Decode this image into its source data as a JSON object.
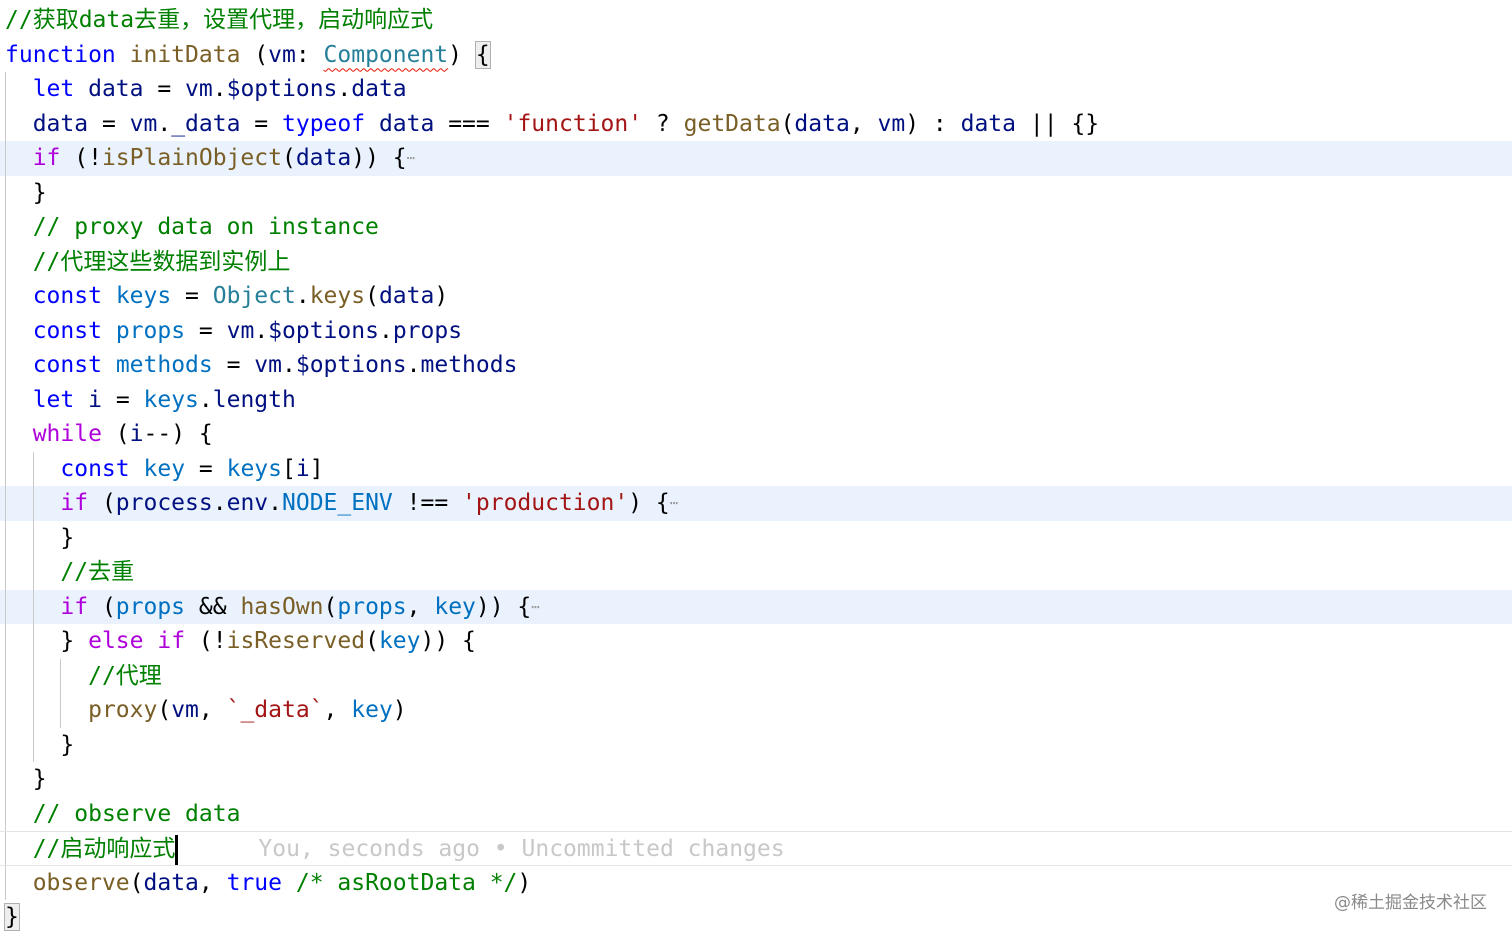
{
  "lines": [
    {
      "indent": 0,
      "tokens": [
        [
          "//获取data去重，设置代理，启动响应式",
          "cm"
        ]
      ]
    },
    {
      "indent": 0,
      "tokens": [
        [
          "function",
          "kw"
        ],
        [
          " ",
          "pl"
        ],
        [
          "initData",
          "fn"
        ],
        [
          " (",
          "pl"
        ],
        [
          "vm",
          "var"
        ],
        [
          ": ",
          "pl"
        ],
        [
          "Component",
          "typ err"
        ],
        [
          ") ",
          "pl"
        ],
        [
          "{",
          "pl brk"
        ]
      ]
    },
    {
      "indent": 1,
      "tokens": [
        [
          "let",
          "kw"
        ],
        [
          " ",
          "pl"
        ],
        [
          "data",
          "var"
        ],
        [
          " = ",
          "pl"
        ],
        [
          "vm",
          "var"
        ],
        [
          ".",
          "pl"
        ],
        [
          "$options",
          "var"
        ],
        [
          ".",
          "pl"
        ],
        [
          "data",
          "var"
        ]
      ]
    },
    {
      "indent": 1,
      "tokens": [
        [
          "data",
          "var"
        ],
        [
          " = ",
          "pl"
        ],
        [
          "vm",
          "var"
        ],
        [
          ".",
          "pl"
        ],
        [
          "_data",
          "var"
        ],
        [
          " = ",
          "pl"
        ],
        [
          "typeof",
          "kw"
        ],
        [
          " ",
          "pl"
        ],
        [
          "data",
          "var"
        ],
        [
          " === ",
          "pl"
        ],
        [
          "'function'",
          "str"
        ],
        [
          " ? ",
          "pl"
        ],
        [
          "getData",
          "fn"
        ],
        [
          "(",
          "pl"
        ],
        [
          "data",
          "var"
        ],
        [
          ", ",
          "pl"
        ],
        [
          "vm",
          "var"
        ],
        [
          ") : ",
          "pl"
        ],
        [
          "data",
          "var"
        ],
        [
          " || {}",
          "pl"
        ]
      ]
    },
    {
      "indent": 1,
      "hl": true,
      "fold": true,
      "tokens": [
        [
          "if",
          "ctl"
        ],
        [
          " (!",
          "pl"
        ],
        [
          "isPlainObject",
          "fn"
        ],
        [
          "(",
          "pl"
        ],
        [
          "data",
          "var"
        ],
        [
          ")) {",
          "pl"
        ]
      ]
    },
    {
      "indent": 1,
      "tokens": [
        [
          "}",
          "pl"
        ]
      ]
    },
    {
      "indent": 1,
      "tokens": [
        [
          "// proxy data on instance",
          "cm"
        ]
      ]
    },
    {
      "indent": 1,
      "tokens": [
        [
          "//代理这些数据到实例上",
          "cm"
        ]
      ]
    },
    {
      "indent": 1,
      "tokens": [
        [
          "const",
          "kw"
        ],
        [
          " ",
          "pl"
        ],
        [
          "keys",
          "cst"
        ],
        [
          " = ",
          "pl"
        ],
        [
          "Object",
          "typ"
        ],
        [
          ".",
          "pl"
        ],
        [
          "keys",
          "fn"
        ],
        [
          "(",
          "pl"
        ],
        [
          "data",
          "var"
        ],
        [
          ")",
          "pl"
        ]
      ]
    },
    {
      "indent": 1,
      "tokens": [
        [
          "const",
          "kw"
        ],
        [
          " ",
          "pl"
        ],
        [
          "props",
          "cst"
        ],
        [
          " = ",
          "pl"
        ],
        [
          "vm",
          "var"
        ],
        [
          ".",
          "pl"
        ],
        [
          "$options",
          "var"
        ],
        [
          ".",
          "pl"
        ],
        [
          "props",
          "var"
        ]
      ]
    },
    {
      "indent": 1,
      "tokens": [
        [
          "const",
          "kw"
        ],
        [
          " ",
          "pl"
        ],
        [
          "methods",
          "cst"
        ],
        [
          " = ",
          "pl"
        ],
        [
          "vm",
          "var"
        ],
        [
          ".",
          "pl"
        ],
        [
          "$options",
          "var"
        ],
        [
          ".",
          "pl"
        ],
        [
          "methods",
          "var"
        ]
      ]
    },
    {
      "indent": 1,
      "tokens": [
        [
          "let",
          "kw"
        ],
        [
          " ",
          "pl"
        ],
        [
          "i",
          "var"
        ],
        [
          " = ",
          "pl"
        ],
        [
          "keys",
          "cst"
        ],
        [
          ".",
          "pl"
        ],
        [
          "length",
          "var"
        ]
      ]
    },
    {
      "indent": 1,
      "tokens": [
        [
          "while",
          "ctl"
        ],
        [
          " (",
          "pl"
        ],
        [
          "i",
          "var"
        ],
        [
          "--) {",
          "pl"
        ]
      ]
    },
    {
      "indent": 2,
      "tokens": [
        [
          "const",
          "kw"
        ],
        [
          " ",
          "pl"
        ],
        [
          "key",
          "cst"
        ],
        [
          " = ",
          "pl"
        ],
        [
          "keys",
          "cst"
        ],
        [
          "[",
          "pl"
        ],
        [
          "i",
          "var"
        ],
        [
          "]",
          "pl"
        ]
      ]
    },
    {
      "indent": 2,
      "hl": true,
      "fold": true,
      "tokens": [
        [
          "if",
          "ctl"
        ],
        [
          " (",
          "pl"
        ],
        [
          "process",
          "var"
        ],
        [
          ".",
          "pl"
        ],
        [
          "env",
          "var"
        ],
        [
          ".",
          "pl"
        ],
        [
          "NODE_ENV",
          "cst"
        ],
        [
          " !== ",
          "pl"
        ],
        [
          "'production'",
          "str"
        ],
        [
          ") {",
          "pl"
        ]
      ]
    },
    {
      "indent": 2,
      "tokens": [
        [
          "}",
          "pl"
        ]
      ]
    },
    {
      "indent": 2,
      "tokens": [
        [
          "//去重",
          "cm"
        ]
      ]
    },
    {
      "indent": 2,
      "hl": true,
      "fold": true,
      "tokens": [
        [
          "if",
          "ctl"
        ],
        [
          " (",
          "pl"
        ],
        [
          "props",
          "cst"
        ],
        [
          " && ",
          "pl"
        ],
        [
          "hasOwn",
          "fn"
        ],
        [
          "(",
          "pl"
        ],
        [
          "props",
          "cst"
        ],
        [
          ", ",
          "pl"
        ],
        [
          "key",
          "cst"
        ],
        [
          ")) {",
          "pl"
        ]
      ]
    },
    {
      "indent": 2,
      "tokens": [
        [
          "} ",
          "pl"
        ],
        [
          "else",
          "ctl"
        ],
        [
          " ",
          "pl"
        ],
        [
          "if",
          "ctl"
        ],
        [
          " (!",
          "pl"
        ],
        [
          "isReserved",
          "fn"
        ],
        [
          "(",
          "pl"
        ],
        [
          "key",
          "cst"
        ],
        [
          ")) {",
          "pl"
        ]
      ]
    },
    {
      "indent": 3,
      "tokens": [
        [
          "//代理",
          "cm"
        ]
      ]
    },
    {
      "indent": 3,
      "tokens": [
        [
          "proxy",
          "fn"
        ],
        [
          "(",
          "pl"
        ],
        [
          "vm",
          "var"
        ],
        [
          ", ",
          "pl"
        ],
        [
          "`_data`",
          "str"
        ],
        [
          ", ",
          "pl"
        ],
        [
          "key",
          "cst"
        ],
        [
          ")",
          "pl"
        ]
      ]
    },
    {
      "indent": 2,
      "tokens": [
        [
          "}",
          "pl"
        ]
      ]
    },
    {
      "indent": 1,
      "tokens": [
        [
          "}",
          "pl"
        ]
      ]
    },
    {
      "indent": 1,
      "tokens": [
        [
          "// observe data",
          "cm"
        ]
      ]
    },
    {
      "indent": 1,
      "cur": true,
      "blame": "You, seconds ago • Uncommitted changes",
      "tokens": [
        [
          "//启动响应式",
          "cm"
        ]
      ]
    },
    {
      "indent": 1,
      "tokens": [
        [
          "observe",
          "fn"
        ],
        [
          "(",
          "pl"
        ],
        [
          "data",
          "var"
        ],
        [
          ", ",
          "pl"
        ],
        [
          "true",
          "kw"
        ],
        [
          " ",
          "pl"
        ],
        [
          "/* asRootData */",
          "cm"
        ],
        [
          ")",
          "pl"
        ]
      ]
    },
    {
      "indent": 0,
      "tokens": [
        [
          "}",
          "pl brk"
        ]
      ]
    }
  ],
  "fold_marker": "⋯",
  "watermark": "@稀土掘金技术社区"
}
